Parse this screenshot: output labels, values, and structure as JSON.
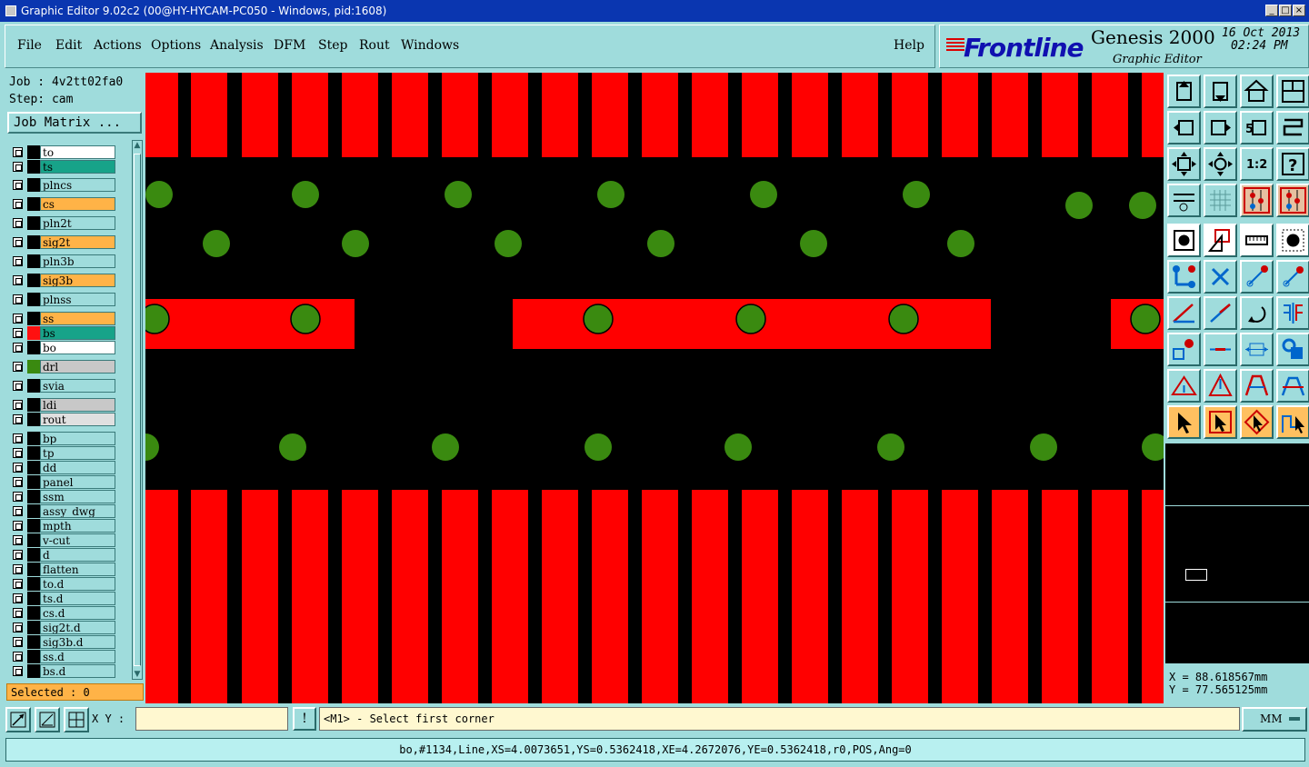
{
  "window": {
    "title": "Graphic Editor 9.02c2 (00@HY-HYCAM-PC050 - Windows, pid:1608)",
    "controls": [
      "minimize",
      "maximize",
      "close"
    ]
  },
  "menu": {
    "items": [
      "File",
      "Edit",
      "Actions",
      "Options",
      "Analysis",
      "DFM",
      "Step",
      "Rout",
      "Windows"
    ],
    "help": "Help"
  },
  "brand": {
    "logo": "Frontline",
    "product": "Genesis 2000",
    "subtitle": "Graphic Editor",
    "date": "16 Oct 2013",
    "time": "02:24 PM"
  },
  "job": {
    "job_label": "Job : 4v2tt02fa0",
    "step_label": "Step: cam",
    "matrix_button": "Job Matrix ..."
  },
  "layers": [
    {
      "name": "to",
      "color": "#ffffff",
      "swatch": "#000000"
    },
    {
      "name": "ts",
      "color": "#17a389",
      "swatch": "#000000"
    },
    {
      "name": "plncs",
      "color": "#9fdcdc",
      "swatch": "#000000"
    },
    {
      "name": "cs",
      "color": "#ffb347",
      "swatch": "#000000"
    },
    {
      "name": "pln2t",
      "color": "#9fdcdc",
      "swatch": "#000000"
    },
    {
      "name": "sig2t",
      "color": "#ffb347",
      "swatch": "#000000"
    },
    {
      "name": "pln3b",
      "color": "#9fdcdc",
      "swatch": "#000000"
    },
    {
      "name": "sig3b",
      "color": "#ffb347",
      "swatch": "#000000"
    },
    {
      "name": "plnss",
      "color": "#9fdcdc",
      "swatch": "#000000"
    },
    {
      "name": "ss",
      "color": "#ffb347",
      "swatch": "#000000"
    },
    {
      "name": "bs",
      "color": "#17a389",
      "swatch": "#ff1010"
    },
    {
      "name": "bo",
      "color": "#ffffff",
      "swatch": "#000000"
    },
    {
      "name": "drl",
      "color": "#c8c8c8",
      "swatch": "#3a8a10"
    },
    {
      "name": "svia",
      "color": "#9fdcdc",
      "swatch": "#000000"
    },
    {
      "name": "ldi",
      "color": "#c8c8c8",
      "swatch": "#000000"
    },
    {
      "name": "rout",
      "color": "#e0e0e0",
      "swatch": "#000000"
    },
    {
      "name": "bp",
      "color": "#9fdcdc",
      "swatch": "#000000"
    },
    {
      "name": "tp",
      "color": "#9fdcdc",
      "swatch": "#000000"
    },
    {
      "name": "dd",
      "color": "#9fdcdc",
      "swatch": "#000000"
    },
    {
      "name": "panel",
      "color": "#9fdcdc",
      "swatch": "#000000"
    },
    {
      "name": "ssm",
      "color": "#9fdcdc",
      "swatch": "#000000"
    },
    {
      "name": "assy_dwg",
      "color": "#9fdcdc",
      "swatch": "#000000"
    },
    {
      "name": "mpth",
      "color": "#9fdcdc",
      "swatch": "#000000"
    },
    {
      "name": "v-cut",
      "color": "#9fdcdc",
      "swatch": "#000000"
    },
    {
      "name": "d",
      "color": "#9fdcdc",
      "swatch": "#000000"
    },
    {
      "name": "flatten",
      "color": "#9fdcdc",
      "swatch": "#000000"
    },
    {
      "name": "to.d",
      "color": "#9fdcdc",
      "swatch": "#000000"
    },
    {
      "name": "ts.d",
      "color": "#9fdcdc",
      "swatch": "#000000"
    },
    {
      "name": "cs.d",
      "color": "#9fdcdc",
      "swatch": "#000000"
    },
    {
      "name": "sig2t.d",
      "color": "#9fdcdc",
      "swatch": "#000000"
    },
    {
      "name": "sig3b.d",
      "color": "#9fdcdc",
      "swatch": "#000000"
    },
    {
      "name": "ss.d",
      "color": "#9fdcdc",
      "swatch": "#000000"
    },
    {
      "name": "bs.d",
      "color": "#9fdcdc",
      "swatch": "#000000"
    }
  ],
  "selected": "Selected : 0",
  "canvas_colors": {
    "background": "#000000",
    "copper": "#ff0000",
    "drill": "#3a8a10"
  },
  "tools": [
    "move-up-icon",
    "move-down-icon",
    "home-icon",
    "zoom-window-icon",
    "pan-left-icon",
    "pan-right-icon",
    "undo-zoom-icon",
    "redraw-icon",
    "fit-icon",
    "zoom-center-icon",
    "scale-1-2-icon",
    "help-query-icon",
    "snap-settings-icon",
    "grid-icon",
    "layer-compare-icon",
    "layer-compare-alt-icon",
    "select-pad-icon",
    "select-shape-icon",
    "ruler-icon",
    "solid-circle-icon",
    "connect-nodes-icon",
    "delete-node-icon",
    "add-node-icon",
    "move-node-icon",
    "angle-line-icon",
    "draw-line-icon",
    "rotate-icon",
    "mirror-icon",
    "pad-route-icon",
    "line-segment-icon",
    "measure-icon",
    "shape-group-icon",
    "triangle-add-icon",
    "triangle-up-icon",
    "arch-icon",
    "arch-alt-icon",
    "pointer-icon",
    "pointer-box-icon",
    "pointer-diamond-icon",
    "pointer-route-icon"
  ],
  "coords": {
    "x": "X = 88.618567mm",
    "y": "Y = 77.565125mm"
  },
  "command": {
    "xy_label": "X Y :",
    "xy_value": "",
    "excl": "!",
    "prompt": "<M1> - Select first corner",
    "units": "MM"
  },
  "status_line": "bo,#1134,Line,XS=4.0073651,YS=0.5362418,XE=4.2672076,YE=0.5362418,r0,POS,Ang=0"
}
